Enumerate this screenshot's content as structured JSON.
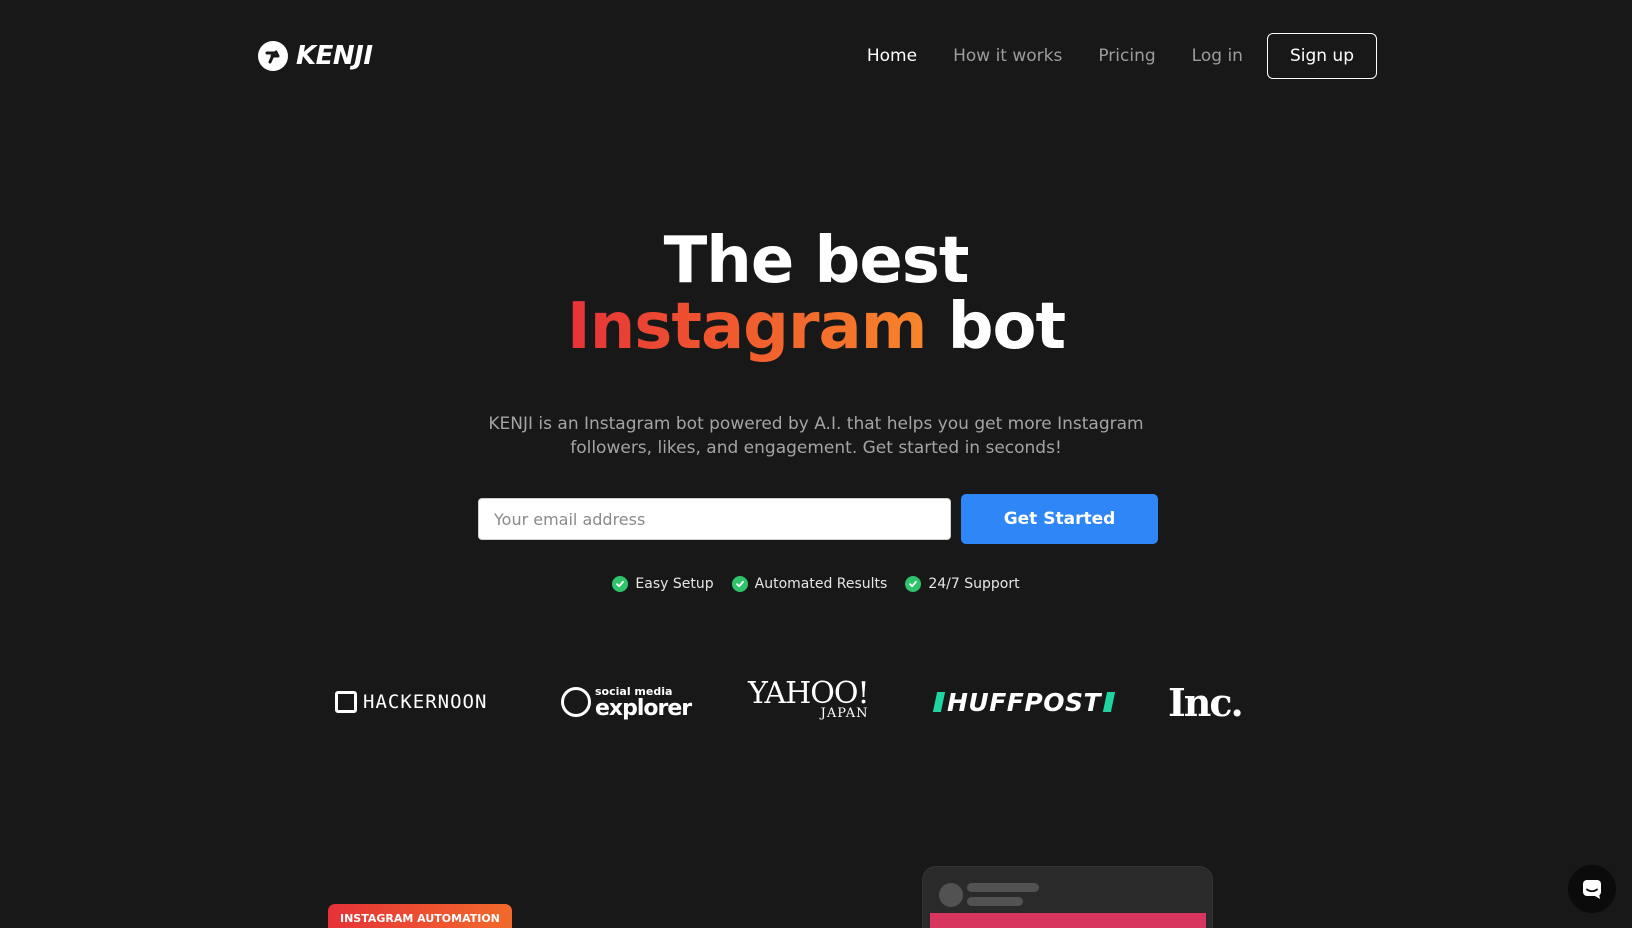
{
  "brand": {
    "name": "KENJI"
  },
  "nav": {
    "items": [
      {
        "label": "Home",
        "active": true
      },
      {
        "label": "How it works",
        "active": false
      },
      {
        "label": "Pricing",
        "active": false
      },
      {
        "label": "Log in",
        "active": false
      }
    ],
    "signup_label": "Sign up"
  },
  "hero": {
    "title_line1": "The best",
    "title_highlight": "Instagram",
    "title_rest": "bot",
    "subtitle": "KENJI is an Instagram bot powered by A.I. that helps you get more Instagram followers, likes, and engagement. Get started in seconds!"
  },
  "form": {
    "email_placeholder": "Your email address",
    "email_value": "",
    "cta_label": "Get Started"
  },
  "features": [
    "Easy Setup",
    "Automated Results",
    "24/7 Support"
  ],
  "press": {
    "hackernoon": "HACKERNOON",
    "sme_small": "social media",
    "sme_big": "explorer",
    "yahoo_big": "YAHOO!",
    "yahoo_small": "JAPAN",
    "huffpost": "HUFFPOST",
    "inc": "Inc."
  },
  "section": {
    "badge": "INSTAGRAM AUTOMATION"
  },
  "colors": {
    "background": "#181818",
    "accent_blue": "#2f86f6",
    "gradient_start": "#e53238",
    "gradient_end": "#f7852a",
    "check_green": "#2fc36b"
  },
  "icons": {
    "chat": "chat-bubble-icon",
    "check": "check-circle-icon",
    "logo": "kenji-logo-icon"
  }
}
